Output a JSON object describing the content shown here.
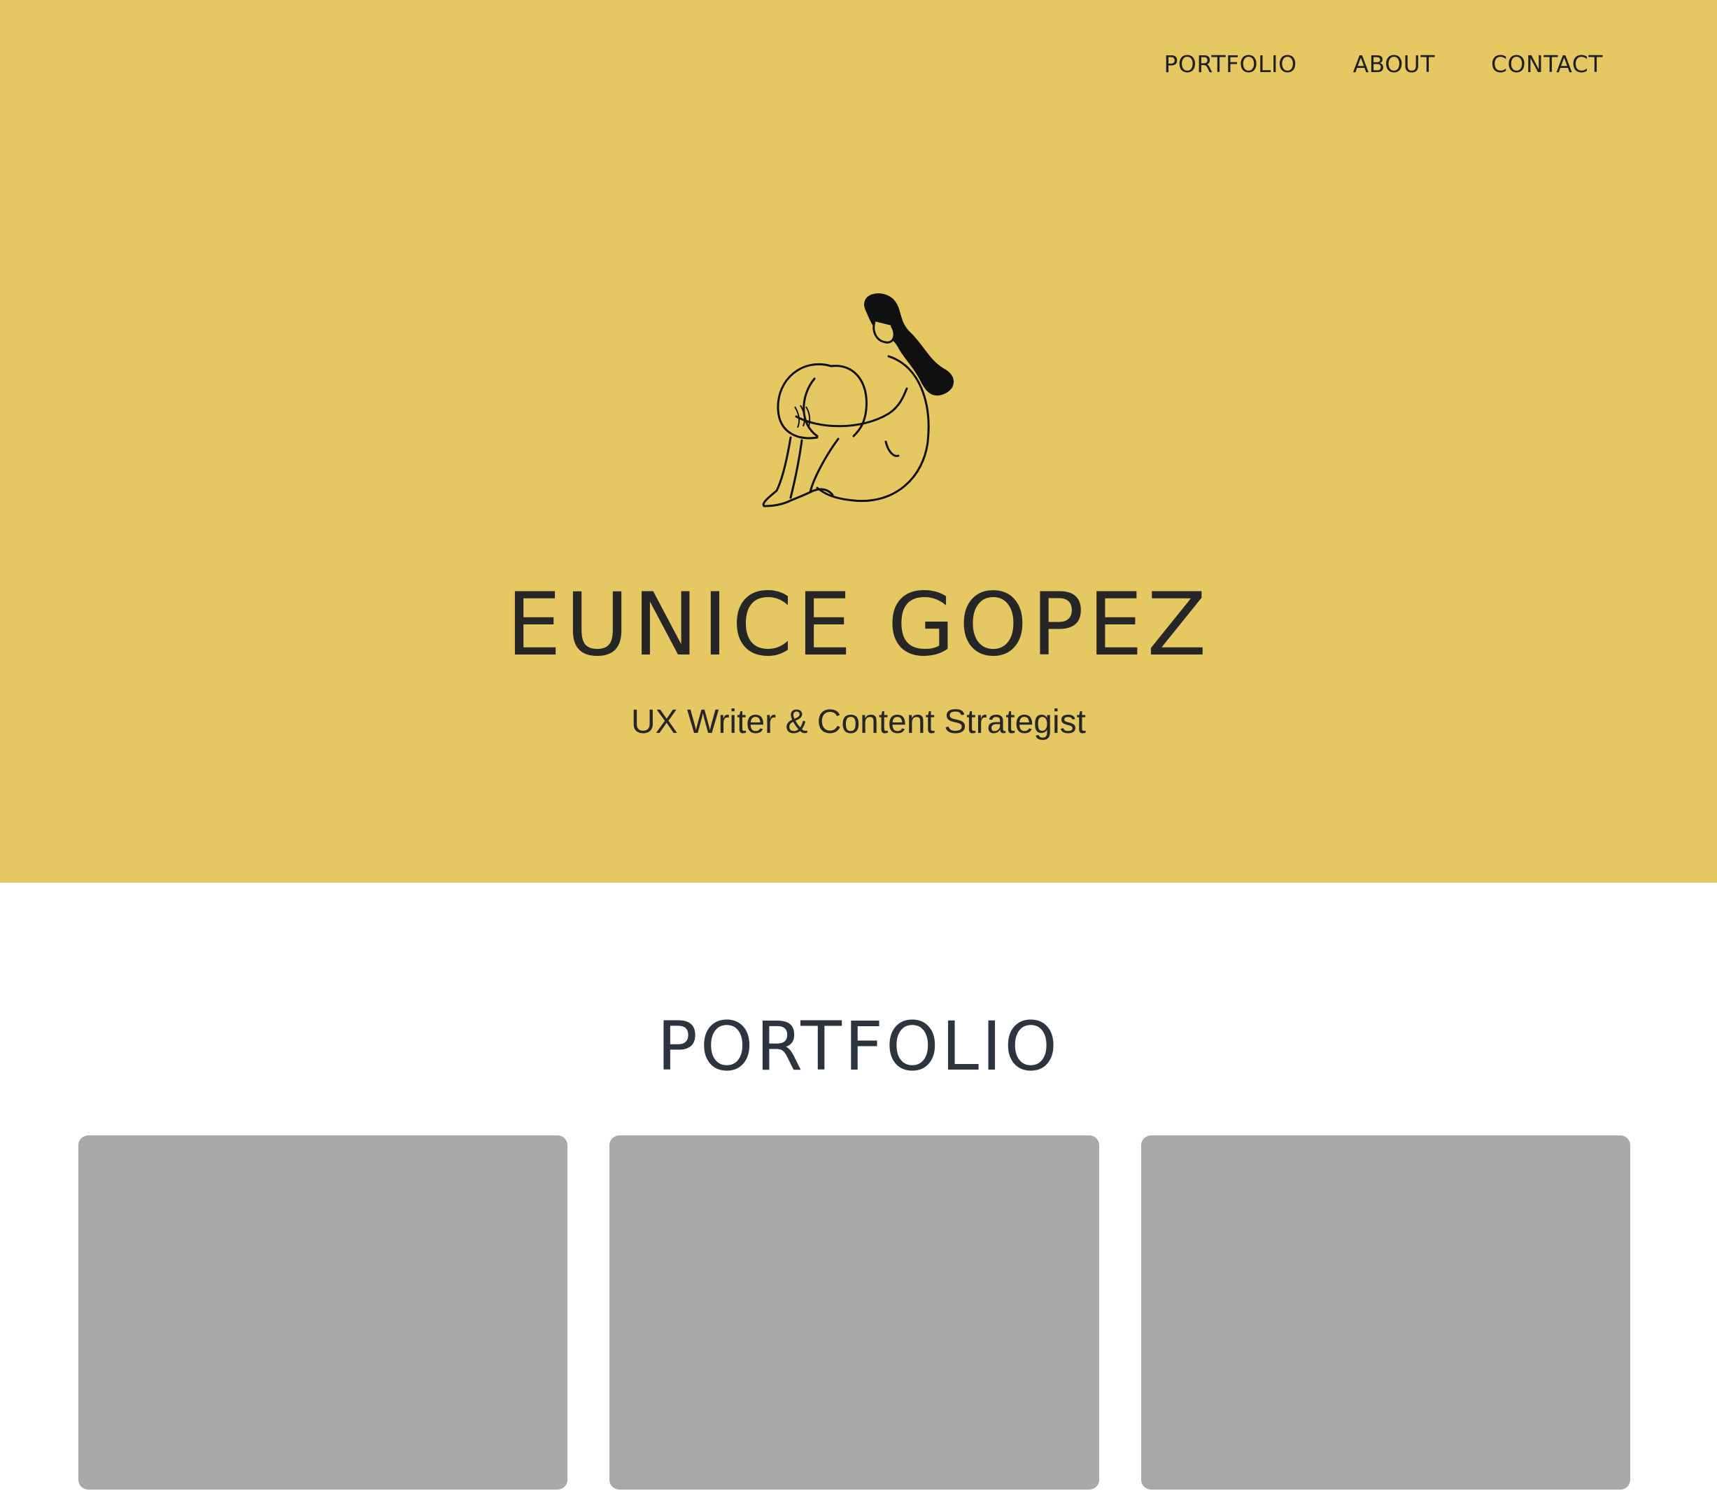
{
  "colors": {
    "hero_background": "#e6c862",
    "card_placeholder": "#a9a9a9",
    "text_dark": "#262626",
    "section_title": "#2c3440"
  },
  "nav": {
    "items": [
      {
        "label": "PORTFOLIO"
      },
      {
        "label": "ABOUT"
      },
      {
        "label": "CONTACT"
      }
    ]
  },
  "hero": {
    "illustration": "woman-sitting-hugging-knees-illustration",
    "name": "EUNICE GOPEZ",
    "subtitle": "UX Writer & Content Strategist"
  },
  "portfolio": {
    "title": "PORTFOLIO",
    "cards": [
      {
        "kind": "image-placeholder"
      },
      {
        "kind": "image-placeholder"
      },
      {
        "kind": "image-placeholder"
      }
    ]
  }
}
